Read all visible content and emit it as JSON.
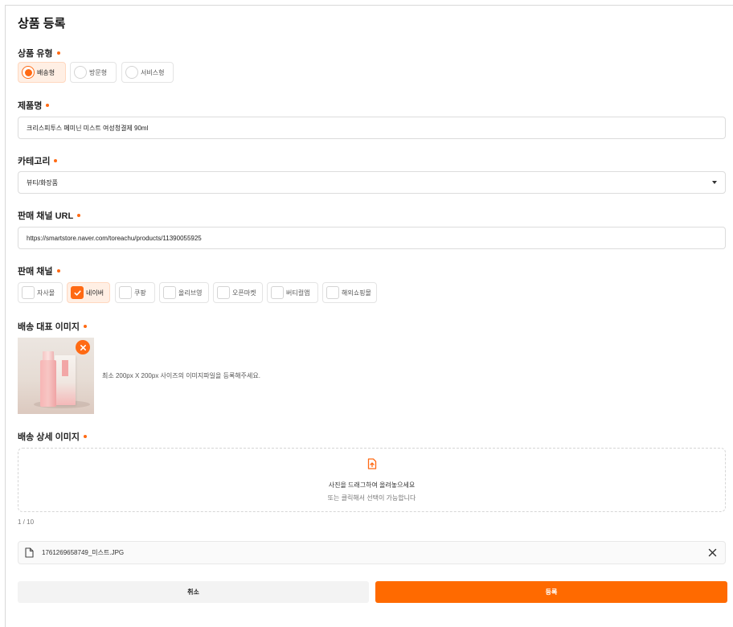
{
  "page": {
    "title": "상품 등록"
  },
  "colors": {
    "accent": "#ff6a14",
    "submit": "#ff6a00"
  },
  "product_type": {
    "label": "상품 유형",
    "options": [
      {
        "label": "배송형",
        "selected": true
      },
      {
        "label": "방문형",
        "selected": false
      },
      {
        "label": "서비스형",
        "selected": false
      }
    ]
  },
  "product_name": {
    "label": "제품명",
    "value": "크리스피투스 페미닌 미스트 여성청결제 90ml"
  },
  "category": {
    "label": "카테고리",
    "value": "뷰티/화장품"
  },
  "channel_url": {
    "label": "판매 채널 URL",
    "value": "https://smartstore.naver.com/toreachu/products/11390055925"
  },
  "channels": {
    "label": "판매 채널",
    "options": [
      {
        "label": "자사몰",
        "checked": false
      },
      {
        "label": "네이버",
        "checked": true
      },
      {
        "label": "쿠팡",
        "checked": false
      },
      {
        "label": "올리브영",
        "checked": false
      },
      {
        "label": "오픈마켓",
        "checked": false
      },
      {
        "label": "버티컬앱",
        "checked": false
      },
      {
        "label": "해외쇼핑몰",
        "checked": false
      }
    ]
  },
  "main_image": {
    "label": "배송 대표 이미지",
    "hint": "최소 200px X 200px 사이즈의 이미지파일을 등록해주세요."
  },
  "detail_images": {
    "label": "배송 상세 이미지",
    "drop_main": "사진을 드래그하여 올려놓으세요",
    "drop_sub": "또는 클릭해서 선택이 가능합니다",
    "count": "1 / 10",
    "files": [
      {
        "name": "1761269658749_미스트.JPG"
      }
    ]
  },
  "actions": {
    "cancel": "취소",
    "submit": "등록"
  }
}
